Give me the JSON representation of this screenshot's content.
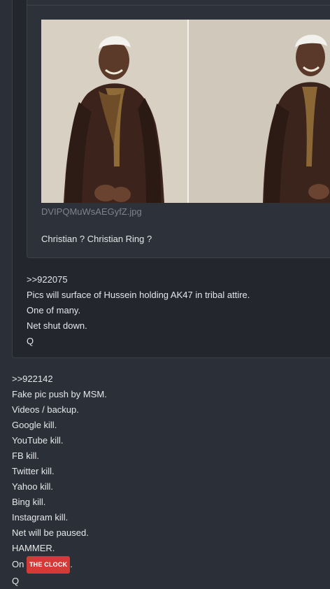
{
  "quoted_post": {
    "image": {
      "filename": "DVIPQMuWsAEGyfZ.jpg",
      "alt_icon": "photo-icon"
    },
    "text": "Christian ? Christian Ring ?"
  },
  "outer_post": {
    "lines": [
      ">>922075",
      "Pics will surface of Hussein holding AK47 in tribal attire.",
      "One of many.",
      "Net shut down.",
      "Q"
    ]
  },
  "main_post": {
    "lines": [
      ">>922142",
      "Fake pic push by MSM.",
      "Videos / backup.",
      "Google kill.",
      "YouTube kill.",
      "FB kill.",
      "Twitter kill.",
      "Yahoo kill.",
      "Bing kill.",
      "Instagram kill.",
      "Net will be paused.",
      "HAMMER."
    ],
    "on_prefix": "On",
    "badge": "THE CLOCK",
    "on_suffix": ".",
    "signature": "Q"
  },
  "colors": {
    "background": "#2b2f37",
    "outer_card": "#23262d",
    "inner_card": "#2d3139",
    "badge": "#d53b36"
  }
}
